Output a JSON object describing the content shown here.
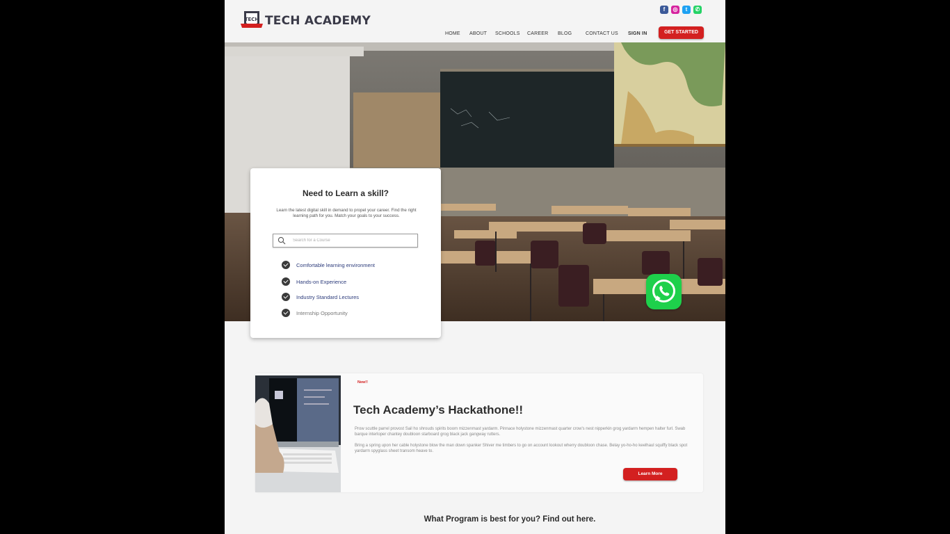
{
  "brand": {
    "name": "TECH ACADEMY",
    "badge_text": "TECH",
    "icon": "shield-logo-icon"
  },
  "socials": [
    {
      "name": "facebook",
      "glyph": "f",
      "color": "#3b5998"
    },
    {
      "name": "instagram",
      "glyph": "◎",
      "color": "#d6249f"
    },
    {
      "name": "twitter",
      "glyph": "t",
      "color": "#1da1f2"
    },
    {
      "name": "whatsapp",
      "glyph": "✆",
      "color": "#25d366"
    }
  ],
  "nav": {
    "home": "HOME",
    "about": "ABOUT",
    "schools": "SCHOOLS",
    "career": "CAREER",
    "blog": "BLOG",
    "contact": "CONTACT US",
    "signin": "SIGN IN",
    "cta": "GET STARTED"
  },
  "hero_card": {
    "title": "Need to Learn a skill?",
    "description": "Learn the latest digital skill in demand to propel your career. Find the right learning path for you. Match your goals to your success.",
    "search_placeholder": "Search for a Course",
    "features": [
      "Comfortable learning environment",
      "Hands-on Experience",
      "Industry Standard Lectures",
      "Internship Opportunity"
    ]
  },
  "news": {
    "tag": "New!!",
    "title": "Tech Academy’s Hackathone!!",
    "paragraph1": "Prow scuttle parrel provost Sail ho shrouds spirits boom mizzenmast yardarm. Pinnace holystone mizzenmast quarter crow's nest nipperkin grog yardarm hempen halter furl. Swab barque interloper chantey doubloon starboard grog black jack gangway rutters.",
    "paragraph2": "Bring a spring upon her cable holystone blow the man down spanker Shiver me timbers to go on account lookout wherry doubloon chase. Belay yo-ho-ho keelhaul squiffy black spot yardarm spyglass sheet transom heave to.",
    "button": "Learn More"
  },
  "program_heading": "What Program is best for you? Find out here.",
  "colors": {
    "accent": "#d32020",
    "whatsapp": "#1ed04b",
    "page_bg": "#f4f4f4"
  }
}
